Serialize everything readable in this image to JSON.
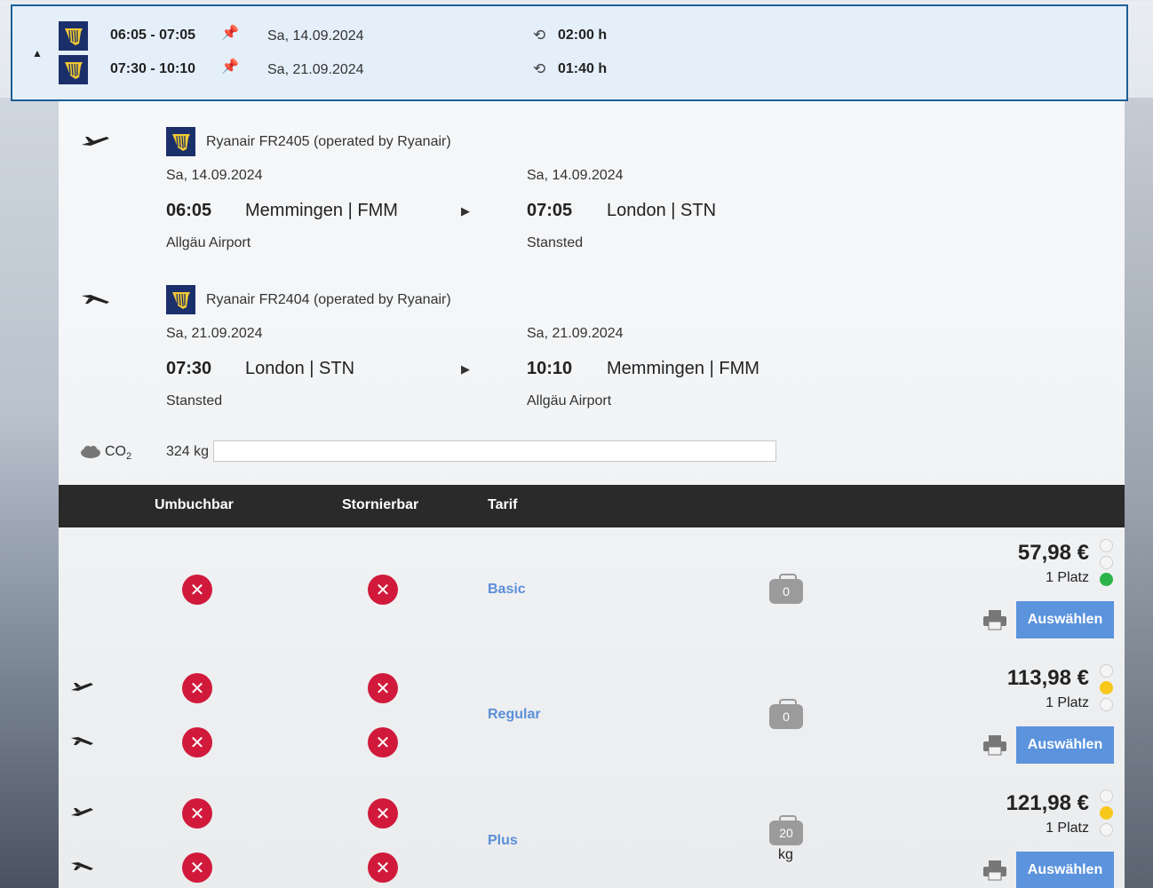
{
  "summary": {
    "outbound": {
      "times": "06:05 - 07:05",
      "date": "Sa,  14.09.2024",
      "duration": "02:00 h"
    },
    "inbound": {
      "times": "07:30 - 10:10",
      "date": "Sa,  21.09.2024",
      "duration": "01:40 h"
    }
  },
  "details": [
    {
      "airline": "Ryanair FR2405 (operated by Ryanair)",
      "dep_date": "Sa, 14.09.2024",
      "dep_time": "06:05",
      "dep_city": "Memmingen | FMM",
      "dep_airport": "Allgäu Airport",
      "arr_date": "Sa, 14.09.2024",
      "arr_time": "07:05",
      "arr_city": "London | STN",
      "arr_airport": "Stansted"
    },
    {
      "airline": "Ryanair FR2404 (operated by Ryanair)",
      "dep_date": "Sa, 21.09.2024",
      "dep_time": "07:30",
      "dep_city": "London | STN",
      "dep_airport": "Stansted",
      "arr_date": "Sa, 21.09.2024",
      "arr_time": "10:10",
      "arr_city": "Memmingen | FMM",
      "arr_airport": "Allgäu Airport"
    }
  ],
  "co2": {
    "label": "CO",
    "sub": "2",
    "value": "324 kg"
  },
  "table_header": {
    "umbuchbar": "Umbuchbar",
    "stornierbar": "Stornierbar",
    "tarif": "Tarif"
  },
  "fares": [
    {
      "name": "Basic",
      "bag": "0",
      "bag_unit": "",
      "price": "57,98 €",
      "seats": "1 Platz",
      "button": "Auswählen"
    },
    {
      "name": "Regular",
      "bag": "0",
      "bag_unit": "",
      "price": "113,98 €",
      "seats": "1 Platz",
      "button": "Auswählen"
    },
    {
      "name": "Plus",
      "bag": "20",
      "bag_unit": "kg",
      "price": "121,98 €",
      "seats": "1 Platz",
      "button": "Auswählen"
    }
  ],
  "colors": {
    "accent": "#5b93dd",
    "header": "#2a2a2a",
    "cancel": "#d11a3b",
    "summary_bg": "#e4effa",
    "summary_border": "#1c5f94"
  }
}
